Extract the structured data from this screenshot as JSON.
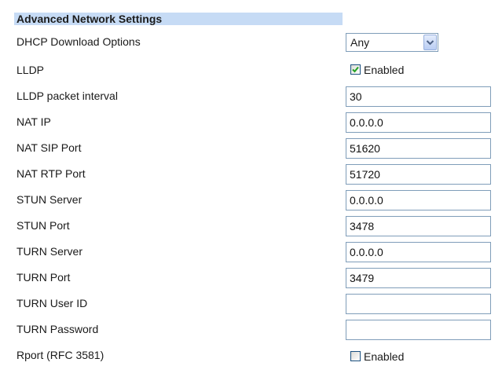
{
  "section": {
    "title": "Advanced Network Settings"
  },
  "dhcp": {
    "label": "DHCP Download Options",
    "selected": "Any",
    "arrow_icon": "chevron-down-icon"
  },
  "lldp": {
    "label": "LLDP",
    "checked": true,
    "check_label": "Enabled"
  },
  "fields": [
    {
      "label": "LLDP packet interval",
      "value": "30"
    },
    {
      "label": "NAT IP",
      "value": "0.0.0.0"
    },
    {
      "label": "NAT SIP Port",
      "value": "51620"
    },
    {
      "label": "NAT RTP Port",
      "value": "51720"
    },
    {
      "label": "STUN Server",
      "value": "0.0.0.0"
    },
    {
      "label": "STUN Port",
      "value": "3478"
    },
    {
      "label": "TURN Server",
      "value": "0.0.0.0"
    },
    {
      "label": "TURN Port",
      "value": "3479"
    },
    {
      "label": "TURN User ID",
      "value": ""
    },
    {
      "label": "TURN Password",
      "value": ""
    }
  ],
  "rport": {
    "label": "Rport (RFC 3581)",
    "checked": false,
    "check_label": "Enabled"
  },
  "colors": {
    "header_bg": "#c6dbf5",
    "input_border": "#7f9db9",
    "checkbox_border": "#1c5180",
    "check_mark": "#21a121"
  }
}
